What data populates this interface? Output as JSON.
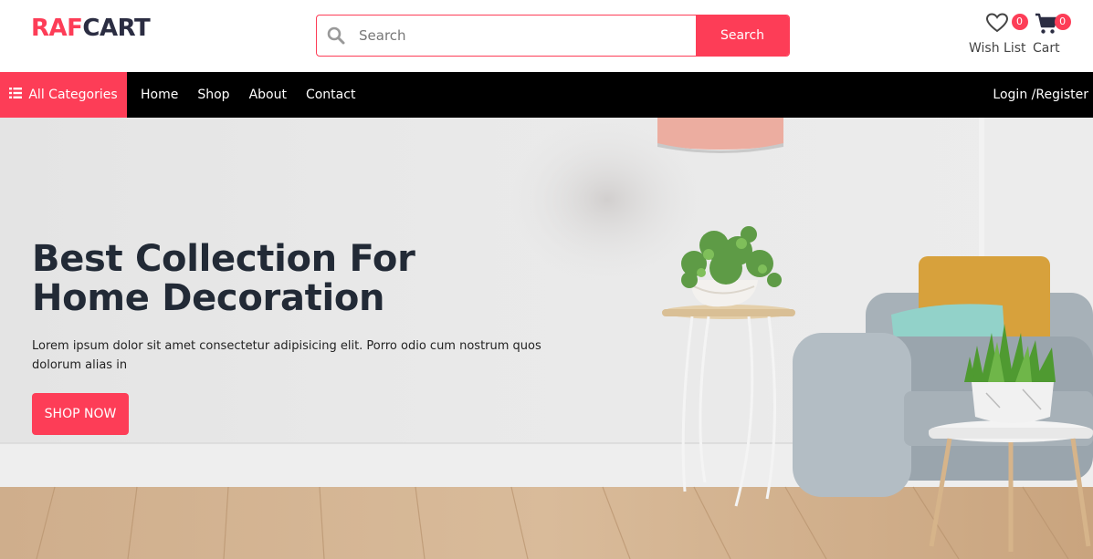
{
  "brand": {
    "logo_part1": "RAF",
    "logo_part2": "CART",
    "accent_color": "#fd3d57"
  },
  "search": {
    "placeholder": "Search",
    "button_label": "Search",
    "icon": "search-icon"
  },
  "header_icons": {
    "wishlist": {
      "label": "Wish List",
      "count": "0",
      "icon": "heart-icon"
    },
    "cart": {
      "label": "Cart",
      "count": "0",
      "icon": "cart-icon"
    }
  },
  "nav": {
    "all_categories": "All Categories",
    "links": [
      "Home",
      "Shop",
      "About",
      "Contact"
    ],
    "login": "Login /Register"
  },
  "hero": {
    "title_line1": "Best Collection For",
    "title_line2": "Home Decoration",
    "text": "Lorem ipsum dolor sit amet consectetur adipisicing elit. Porro odio cum nostrum quos dolorum alias in",
    "cta": "SHOP NOW"
  }
}
